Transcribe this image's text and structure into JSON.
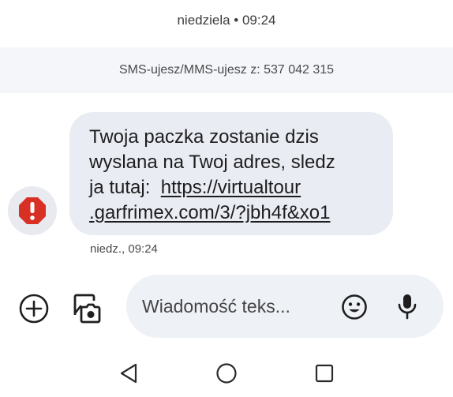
{
  "header": {
    "date_time": "niedziela • 09:24"
  },
  "banner": {
    "text": "SMS-ujesz/MMS-ujesz z: 537 042 315"
  },
  "message": {
    "line1": "Twoja paczka zostanie dzis",
    "line2": "wyslana na Twoj adres, sledz",
    "line3_prefix": "ja tutaj:  ",
    "link_part1": "https://virtualtour",
    "link_part2": ".garfrimex.com/3/?jbh4f&xo1",
    "timestamp": "niedz., 09:24",
    "sender_icon": "alert-octagon-icon",
    "sender_icon_color": "#d93025"
  },
  "composer": {
    "placeholder": "Wiadomość teks...",
    "value": "",
    "attach_icon": "add-circle-icon",
    "gallery_icon": "photo-camera-icon",
    "emoji_icon": "emoji-icon",
    "mic_icon": "microphone-icon"
  },
  "nav": {
    "back_icon": "back-triangle-icon",
    "home_icon": "home-circle-icon",
    "recents_icon": "recents-square-icon"
  }
}
